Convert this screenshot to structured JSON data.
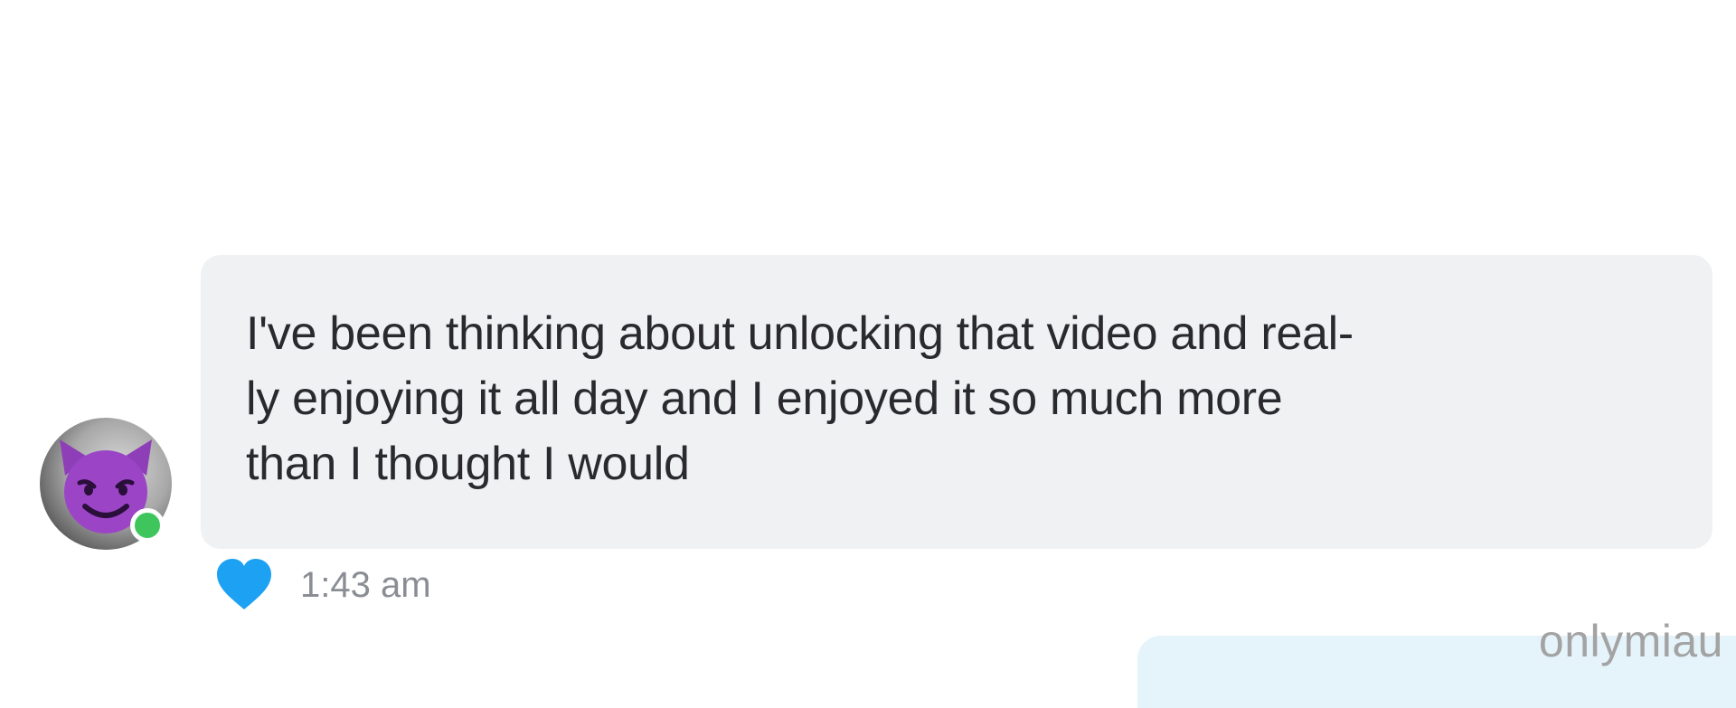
{
  "message": {
    "text": "I've been thinking about unlocking that video and real-\nly enjoying it all day and I enjoyed it so much more\nthan I thought I would",
    "timestamp": "1:43 am",
    "liked": true
  },
  "sender": {
    "avatar_icon": "smiling-devil-emoji",
    "online": true
  },
  "watermark": "onlymiau",
  "colors": {
    "bubble_incoming": "#f0f1f3",
    "bubble_outgoing": "#e5f4fb",
    "heart": "#1da1f2",
    "online": "#3ec65d",
    "emoji": "#8e3fb8"
  }
}
